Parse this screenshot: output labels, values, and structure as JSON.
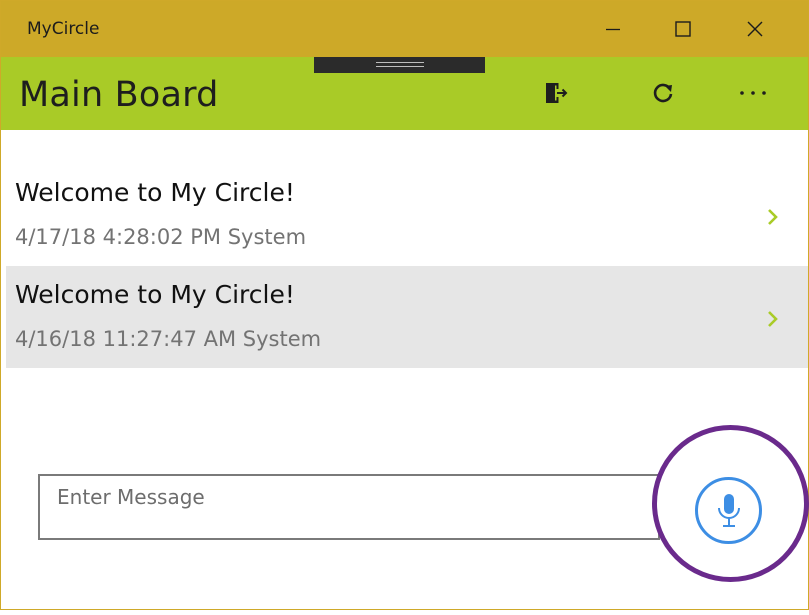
{
  "window": {
    "title": "MyCircle",
    "titlebar_color": "#cda928"
  },
  "appbar": {
    "title": "Main Board",
    "color": "#a9cb27",
    "buttons": {
      "sign_out_icon": "sign-out-icon",
      "refresh_icon": "refresh-icon",
      "more_icon": "more-icon",
      "more_glyph": "···"
    }
  },
  "messages": [
    {
      "title": "Welcome to My Circle!",
      "meta": "4/17/18 4:28:02 PM System",
      "selected": false
    },
    {
      "title": "Welcome to My Circle!",
      "meta": "4/16/18 11:27:47 AM System",
      "selected": true
    }
  ],
  "composer": {
    "placeholder": "Enter Message",
    "value": ""
  },
  "mic": {
    "icon": "microphone-icon",
    "accent": "#3d8ee4",
    "highlight_ring": "#6a2a8c"
  },
  "colors": {
    "chevron": "#a9cb27",
    "selected_row": "#e6e6e6"
  }
}
